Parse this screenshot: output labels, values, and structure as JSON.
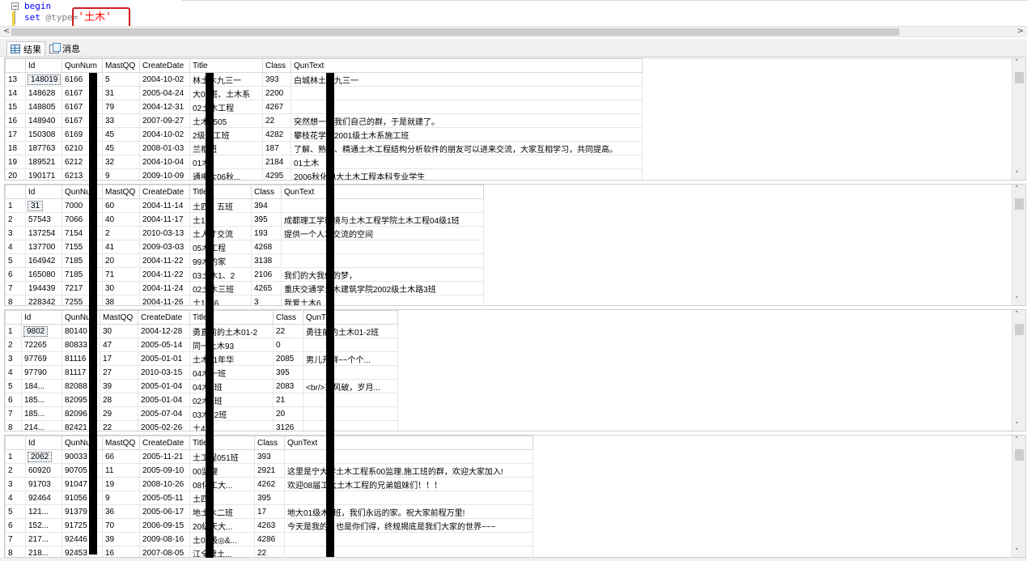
{
  "editor": {
    "line1_kw": "begin",
    "line2_kw": "set",
    "line2_var": "@type",
    "line2_op": "=",
    "line2_str": "'土木'"
  },
  "tabs": [
    {
      "label": "结果",
      "icon": "grid-icon"
    },
    {
      "label": "消息",
      "icon": "message-icon"
    }
  ],
  "panes": [
    {
      "columns": [
        "Id",
        "QunNum",
        "MastQQ",
        "CreateDate",
        "Title",
        "Class",
        "QunText"
      ],
      "rows": [
        [
          "13",
          "148019",
          "6166",
          "5",
          "2004-10-02",
          "林土木九三一",
          "393",
          "白城林土木九三一"
        ],
        [
          "14",
          "148628",
          "6167",
          "31",
          "2005-04-24",
          "大08班、土木系",
          "2200",
          ""
        ],
        [
          "15",
          "148805",
          "6167",
          "79",
          "2004-12-31",
          "02土木工程",
          "4267",
          ""
        ],
        [
          "16",
          "148940",
          "6167",
          "33",
          "2007-09-27",
          "土木0505",
          "22",
          "突然想一个我们自己的群，于是就建了。"
        ],
        [
          "17",
          "150308",
          "6169",
          "45",
          "2004-10-02",
          "2级施工班",
          "4282",
          "攀枝花学院2001级土木系施工班"
        ],
        [
          "18",
          "187763",
          "6210",
          "45",
          "2008-01-03",
          "兰枢纽",
          "187",
          "了解、熟悉、精通土木工程结构分析软件的朋友可以进来交流，大家互相学习，共同提高。"
        ],
        [
          "19",
          "189521",
          "6212",
          "32",
          "2004-10-04",
          "01木",
          "2184",
          "01土木"
        ],
        [
          "20",
          "190171",
          "6213",
          "9",
          "2009-10-09",
          "通电大06秋...",
          "4295",
          "2006秋化电大土木工程本科专业学生"
        ]
      ]
    },
    {
      "columns": [
        "Id",
        "QunNum",
        "MastQQ",
        "CreateDate",
        "Title",
        "Class",
        "QunText"
      ],
      "rows": [
        [
          "1",
          "31",
          "7000",
          "60",
          "2004-11-14",
          "土四、五班",
          "394",
          ""
        ],
        [
          "2",
          "57543",
          "7066",
          "40",
          "2004-11-17",
          "土1班",
          "395",
          "成都理工学环境与土木工程学院土木工程04级1班"
        ],
        [
          "3",
          "137254",
          "7154",
          "2",
          "2010-03-13",
          "土人才交流",
          "193",
          "提供一个人才交流的空间"
        ],
        [
          "4",
          "137700",
          "7155",
          "41",
          "2009-03-03",
          "05木工程",
          "4268",
          ""
        ],
        [
          "5",
          "164942",
          "7185",
          "20",
          "2004-11-22",
          "99木的家",
          "3138",
          ""
        ],
        [
          "6",
          "165080",
          "7185",
          "71",
          "2004-11-22",
          "03土木1、2",
          "2106",
          "我们的大我们的梦，"
        ],
        [
          "7",
          "194439",
          "7217",
          "30",
          "2004-11-24",
          "02土木三班",
          "4265",
          "重庆交通学土木建筑学院2002级土木路3班"
        ],
        [
          "8",
          "228342",
          "7255",
          "38",
          "2004-11-26",
          "土1046",
          "3",
          "我爱土木6"
        ]
      ]
    },
    {
      "columns": [
        "Id",
        "QunNu",
        "MastQQ",
        "CreateDate",
        "Title",
        "Class",
        "QunT"
      ],
      "rows": [
        [
          "1",
          "9802",
          "80140",
          "30",
          "2004-12-28",
          "勇直前的土木01-2",
          "22",
          "勇往前的土木01-2班"
        ],
        [
          "2",
          "72265",
          "80833",
          "47",
          "2005-05-14",
          "同一土木93",
          "0",
          ""
        ],
        [
          "3",
          "97769",
          "81116",
          "17",
          "2005-01-01",
          "土木41年华",
          "2085",
          "男儿开群~~个个..."
        ],
        [
          "4",
          "97790",
          "81117",
          "27",
          "2010-03-15",
          "04木一班",
          "395",
          ""
        ],
        [
          "5",
          "184...",
          "82088",
          "39",
          "2005-01-04",
          "04木6班",
          "2083",
          "<br/>东风破，岁月..."
        ],
        [
          "6",
          "185...",
          "82095",
          "28",
          "2005-01-04",
          "02木1班",
          "21",
          ""
        ],
        [
          "7",
          "185...",
          "82096",
          "29",
          "2005-07-04",
          "03木12班",
          "20",
          ""
        ],
        [
          "8",
          "214...",
          "82421",
          "22",
          "2005-02-26",
          "土4",
          "3126",
          ""
        ]
      ]
    },
    {
      "columns": [
        "Id",
        "QunNu",
        "MastQQ",
        "CreateDate",
        "Title",
        "Class",
        "QunText"
      ],
      "rows": [
        [
          "1",
          "2062",
          "90033",
          "66",
          "2005-11-21",
          "土工程051班",
          "393",
          ""
        ],
        [
          "2",
          "60920",
          "90705",
          "11",
          "2005-09-10",
          "00监理",
          "2921",
          "这里是宁大学土木工程系00监理.施工班的群，欢迎大家加入!"
        ],
        [
          "3",
          "91703",
          "91047",
          "19",
          "2008-10-26",
          "08化工大...",
          "4262",
          "欢迎08届工大土木工程的兄弟姐妹们！！！"
        ],
        [
          "4",
          "92464",
          "91056",
          "9",
          "2005-05-11",
          "土四",
          "395",
          ""
        ],
        [
          "5",
          "121...",
          "91379",
          "36",
          "2005-06-17",
          "地土木二班",
          "17",
          "地大01级木2班，我们永远的家。祝大家前程万里!"
        ],
        [
          "6",
          "152...",
          "91725",
          "70",
          "2006-09-15",
          "20级天大...",
          "4263",
          "今天是我的，也是你们得，终规揭底是我们大家的世界~~~"
        ],
        [
          "7",
          "217...",
          "92446",
          "39",
          "2009-08-16",
          "土09级◎&...",
          "4286",
          ""
        ],
        [
          "8",
          "218...",
          "92453",
          "16",
          "2007-08-05",
          "江全管土...",
          "22",
          ""
        ]
      ]
    }
  ]
}
